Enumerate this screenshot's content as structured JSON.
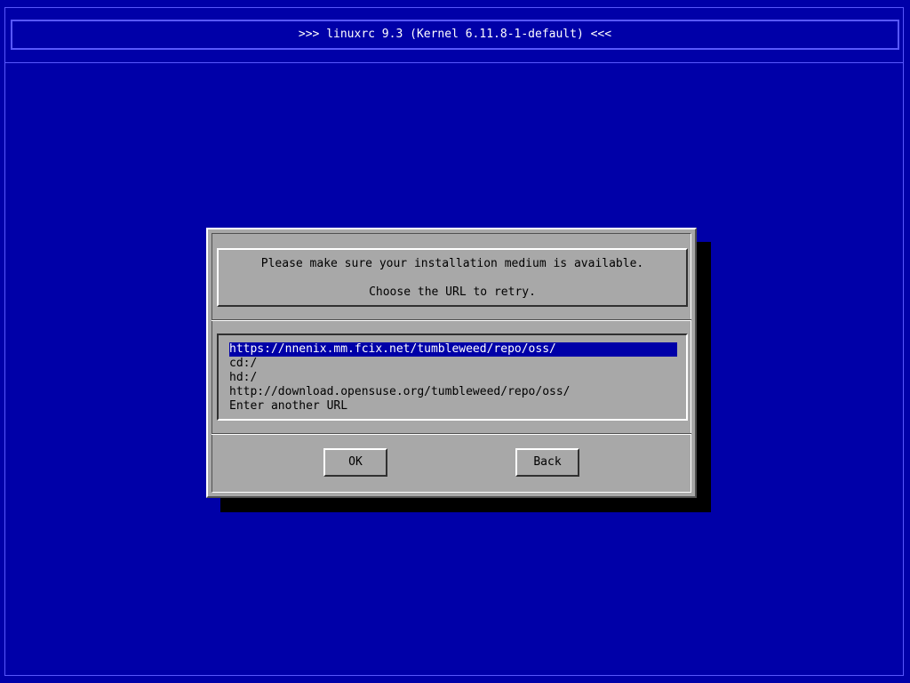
{
  "header": {
    "title": ">>> linuxrc 9.3 (Kernel 6.11.8-1-default) <<<"
  },
  "dialog": {
    "message_line1": "Please make sure your installation medium is available.",
    "message_line2": "Choose the URL to retry.",
    "url_list": {
      "selected_index": 0,
      "items": [
        "https://nnenix.mm.fcix.net/tumbleweed/repo/oss/",
        "cd:/",
        "hd:/",
        "http://download.opensuse.org/tumbleweed/repo/oss/",
        "Enter another URL"
      ]
    },
    "buttons": {
      "ok_label": "OK",
      "back_label": "Back"
    }
  },
  "colors": {
    "background": "#0000a8",
    "dialog": "#a8a8a8",
    "selection": "#0000a8",
    "frame": "#5858fc"
  }
}
